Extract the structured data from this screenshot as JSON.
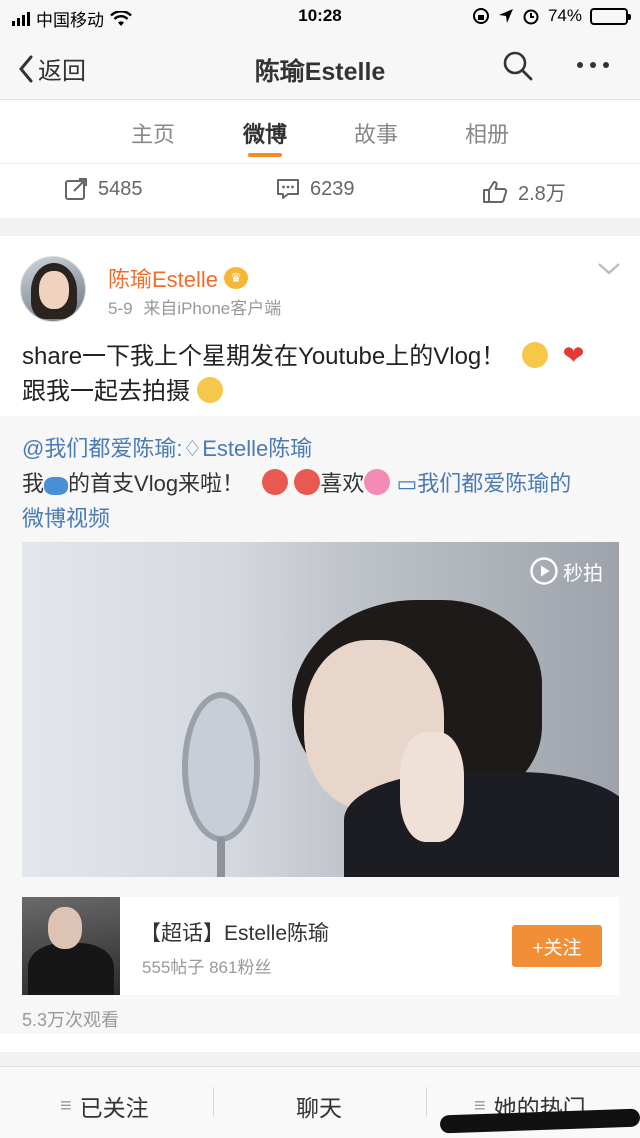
{
  "status_bar": {
    "carrier": "中国移动",
    "time": "10:28",
    "battery": "74%",
    "battery_level": 0.74
  },
  "nav": {
    "back_label": "返回",
    "title": "陈瑜Estelle"
  },
  "tabs": [
    {
      "label": "主页"
    },
    {
      "label": "微博"
    },
    {
      "label": "故事"
    },
    {
      "label": "相册"
    }
  ],
  "stats": {
    "reposts": "5485",
    "comments": "6239",
    "likes": "2.8万"
  },
  "post": {
    "author": "陈瑜Estelle",
    "date": "5-9",
    "source": "来自iPhone客户端",
    "text_line1": "share一下我上个星期发在Youtube上的Vlog！",
    "text_line2": "跟我一起去拍摄",
    "repost": {
      "mention": "@我们都爱陈瑜:",
      "mention_name": "Estelle陈瑜",
      "text_a": "我",
      "text_b": "的首支Vlog来啦！",
      "text_c": "喜欢",
      "video_link_line1": "我们都爱陈瑜的",
      "video_link_line2": "微博视频",
      "video_brand": "秒拍",
      "topic_name": "【超话】Estelle陈瑜",
      "topic_stats": "555帖子 861粉丝",
      "follow_label": "+关注",
      "views": "5.3万次观看"
    }
  },
  "bottom": {
    "followed": "已关注",
    "chat": "聊天",
    "hot": "她的热门"
  }
}
